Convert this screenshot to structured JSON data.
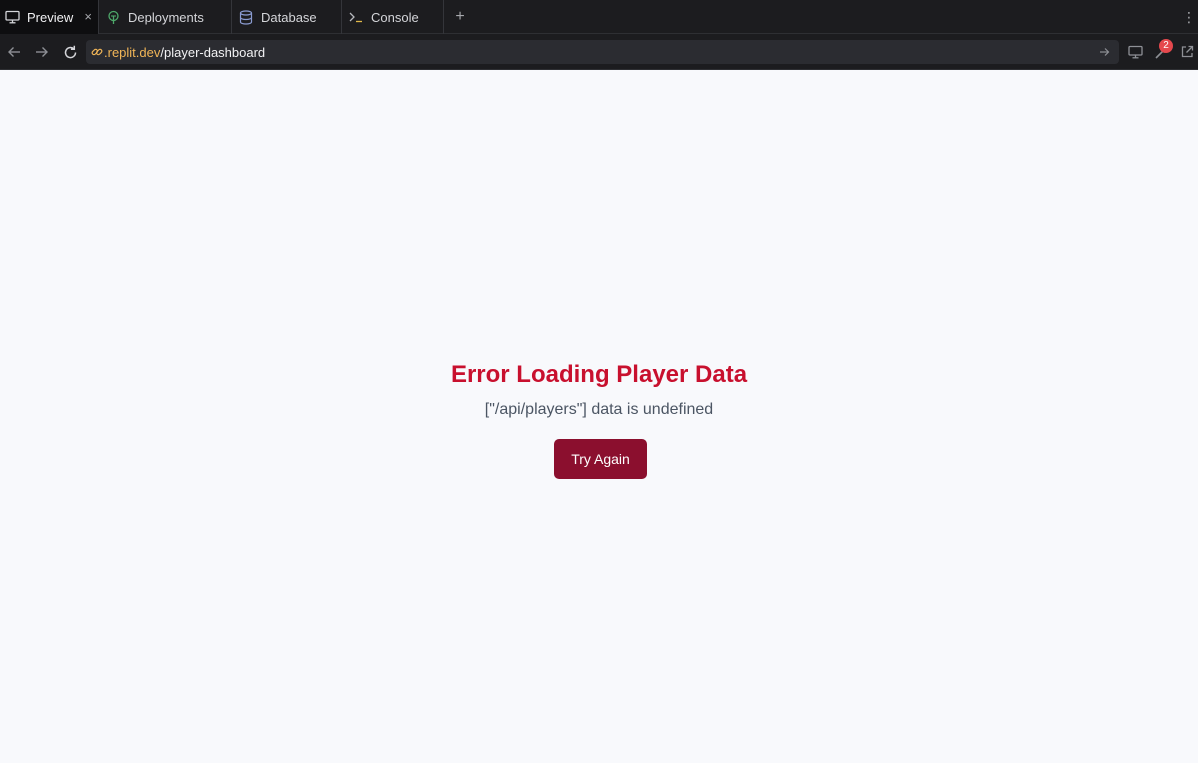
{
  "tabs": [
    {
      "label": "Preview",
      "icon": "monitor-icon",
      "active": true,
      "closable": true
    },
    {
      "label": "Deployments",
      "icon": "deployments-icon",
      "active": false
    },
    {
      "label": "Database",
      "icon": "database-icon",
      "active": false
    },
    {
      "label": "Console",
      "icon": "terminal-icon",
      "active": false
    }
  ],
  "tab_close_glyph": "×",
  "add_tab_glyph": "+",
  "menu_glyph": "⋮",
  "address": {
    "domain": ".replit.dev",
    "path": "/player-dashboard"
  },
  "notifications": {
    "count": "2"
  },
  "error": {
    "title": "Error Loading Player Data",
    "message": "[\"/api/players\"] data is undefined",
    "retry_label": "Try Again"
  },
  "colors": {
    "accent_error": "#c8102e",
    "button_bg": "#8b0f2e",
    "url_domain": "#f0b557",
    "badge": "#e5484d"
  }
}
